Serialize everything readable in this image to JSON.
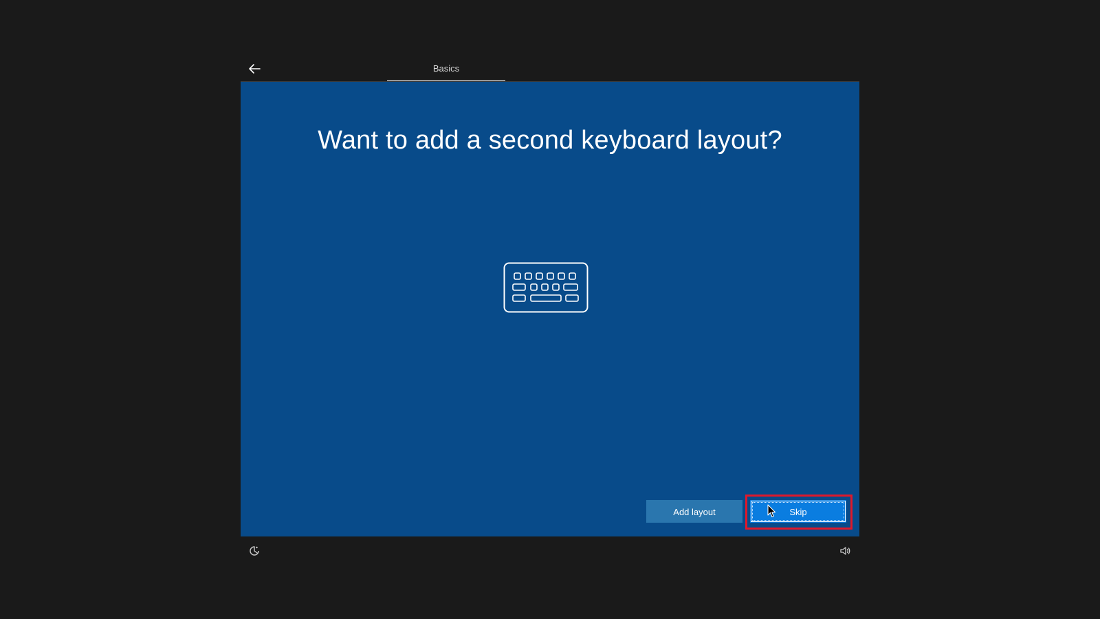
{
  "header": {
    "back_icon": "back-arrow-icon",
    "tab_label": "Basics"
  },
  "main": {
    "title": "Want to add a second keyboard layout?",
    "illustration_icon": "keyboard-icon",
    "buttons": {
      "add_layout": "Add layout",
      "skip": "Skip"
    },
    "focused_button": "skip",
    "highlight_color": "#e0182a"
  },
  "footer": {
    "accessibility_icon": "ease-of-access-icon",
    "volume_icon": "volume-icon"
  },
  "colors": {
    "background": "#1a1a1a",
    "panel": "#084b8a",
    "primary_button": "#0a7de0",
    "secondary_button": "#2a76ae"
  }
}
